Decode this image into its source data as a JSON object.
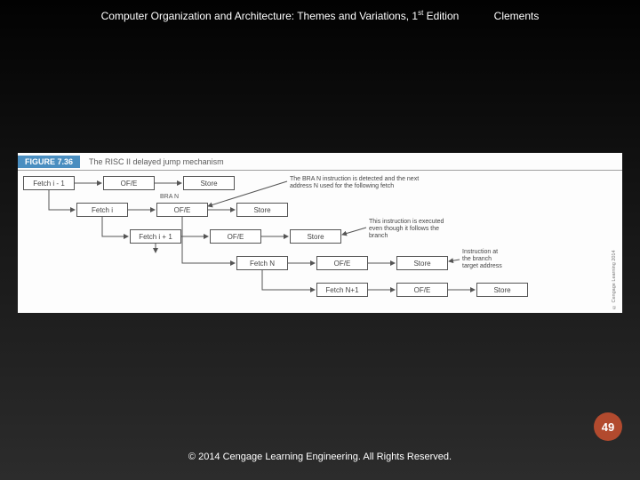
{
  "header": {
    "title_pre": "Computer Organization and Architecture: Themes and Variations, 1",
    "title_sup": "st",
    "title_post": " Edition",
    "author": "Clements"
  },
  "figure": {
    "badge": "FIGURE 7.36",
    "caption": "The RISC II delayed jump mechanism",
    "side_copyright": "© Cengage Learning 2014",
    "bra_label": "BRA  N",
    "rows": {
      "r0": {
        "fetch": "Fetch i - 1",
        "ofe": "OF/E",
        "store": "Store"
      },
      "r1": {
        "fetch": "Fetch i",
        "ofe": "OF/E",
        "store": "Store"
      },
      "r2": {
        "fetch": "Fetch i + 1",
        "ofe": "OF/E",
        "store": "Store"
      },
      "r3": {
        "fetch": "Fetch N",
        "ofe": "OF/E",
        "store": "Store"
      },
      "r4": {
        "fetch": "Fetch N+1",
        "ofe": "OF/E",
        "store": "Store"
      }
    },
    "notes": {
      "n1a": "The BRA  N instruction is detected and the next",
      "n1b": "address N used for the following fetch",
      "n2a": "This instruction is executed",
      "n2b": "even though it follows the",
      "n2c": "branch",
      "n3a": "Instruction at",
      "n3b": "the branch",
      "n3c": "target address"
    }
  },
  "page_number": "49",
  "footer": "© 2014 Cengage Learning Engineering. All Rights Reserved."
}
